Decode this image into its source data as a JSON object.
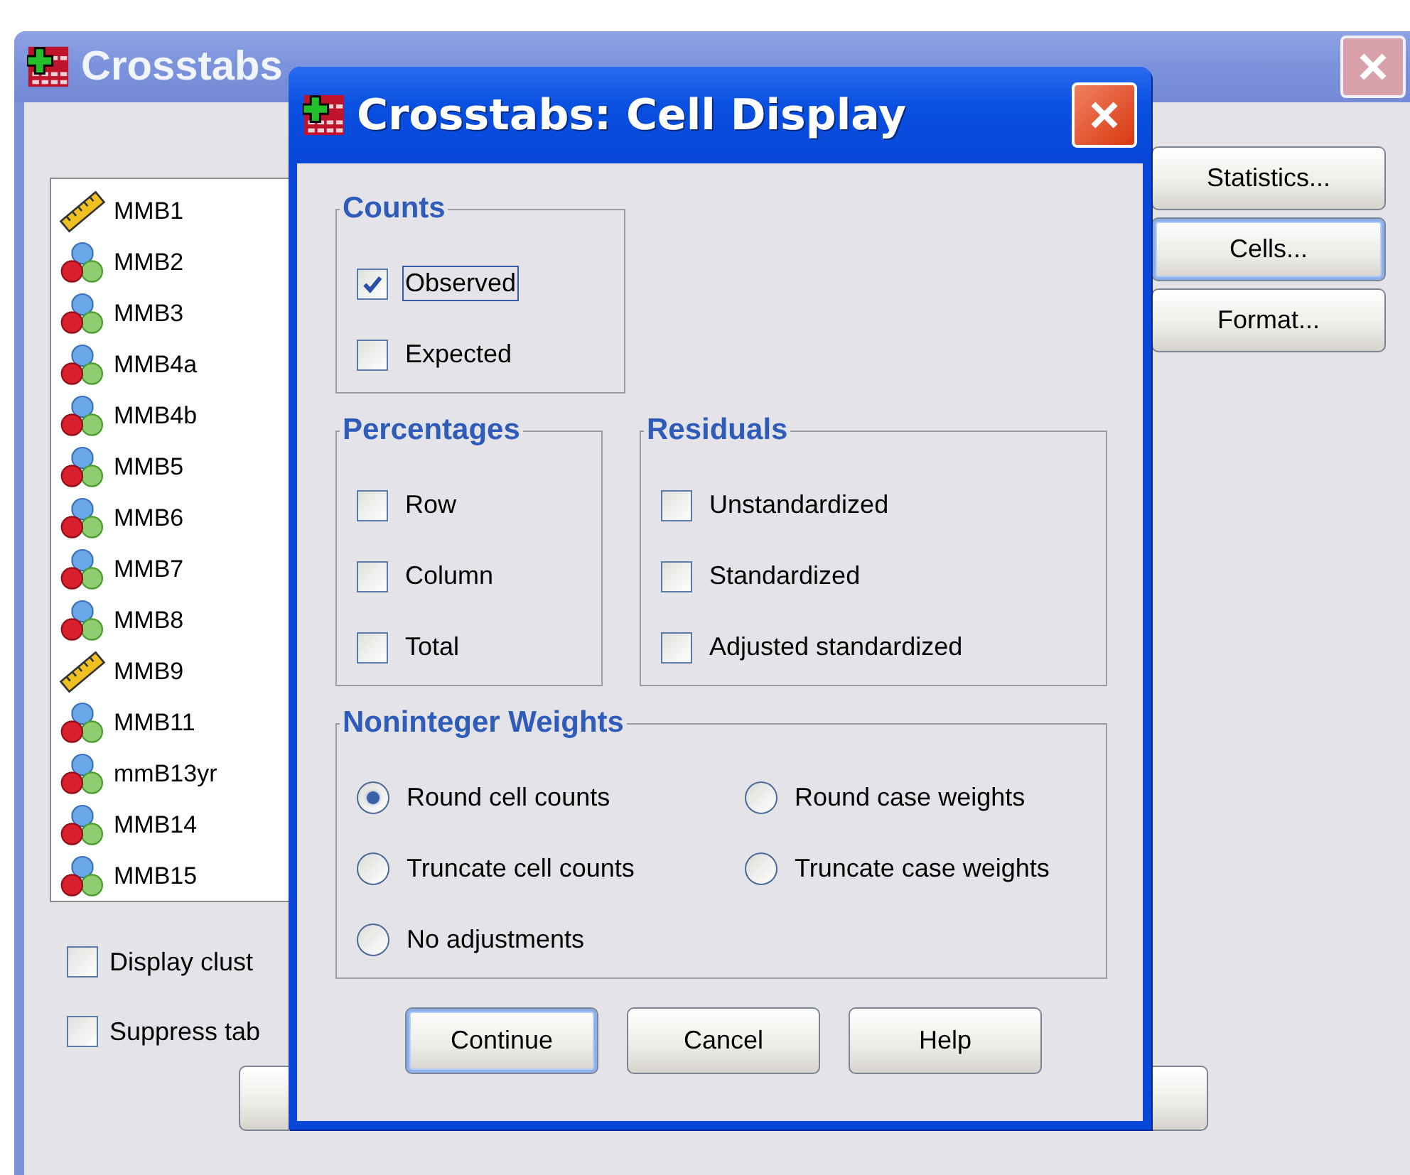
{
  "background_window": {
    "title": "Crosstabs",
    "variables": [
      {
        "name": "MMB1",
        "kind": "scale"
      },
      {
        "name": "MMB2",
        "kind": "nominal"
      },
      {
        "name": "MMB3",
        "kind": "nominal"
      },
      {
        "name": "MMB4a",
        "kind": "nominal"
      },
      {
        "name": "MMB4b",
        "kind": "nominal"
      },
      {
        "name": "MMB5",
        "kind": "nominal"
      },
      {
        "name": "MMB6",
        "kind": "nominal"
      },
      {
        "name": "MMB7",
        "kind": "nominal"
      },
      {
        "name": "MMB8",
        "kind": "nominal"
      },
      {
        "name": "MMB9",
        "kind": "scale"
      },
      {
        "name": "MMB11",
        "kind": "nominal"
      },
      {
        "name": "mmB13yr",
        "kind": "nominal"
      },
      {
        "name": "MMB14",
        "kind": "nominal"
      },
      {
        "name": "MMB15",
        "kind": "nominal"
      }
    ],
    "side_buttons": [
      {
        "label": "Statistics...",
        "focused": false
      },
      {
        "label": "Cells...",
        "focused": true
      },
      {
        "label": "Format...",
        "focused": false
      }
    ],
    "options": [
      {
        "label": "Display clust",
        "checked": false
      },
      {
        "label": "Suppress tab",
        "checked": false
      }
    ]
  },
  "dialog": {
    "title": "Crosstabs: Cell Display",
    "groups": [
      {
        "title": "Counts",
        "items": [
          {
            "kind": "checkbox",
            "label": "Observed",
            "checked": true,
            "focused": true
          },
          {
            "kind": "checkbox",
            "label": "Expected",
            "checked": false,
            "focused": false
          }
        ]
      },
      {
        "title": "Percentages",
        "items": [
          {
            "kind": "checkbox",
            "label": "Row",
            "checked": false,
            "focused": false
          },
          {
            "kind": "checkbox",
            "label": "Column",
            "checked": false,
            "focused": false
          },
          {
            "kind": "checkbox",
            "label": "Total",
            "checked": false,
            "focused": false
          }
        ]
      },
      {
        "title": "Residuals",
        "items": [
          {
            "kind": "checkbox",
            "label": "Unstandardized",
            "checked": false,
            "focused": false
          },
          {
            "kind": "checkbox",
            "label": "Standardized",
            "checked": false,
            "focused": false
          },
          {
            "kind": "checkbox",
            "label": "Adjusted standardized",
            "checked": false,
            "focused": false
          }
        ]
      },
      {
        "title": "Noninteger Weights",
        "items": [
          {
            "kind": "radio",
            "label": "Round cell counts",
            "selected": true,
            "focused": false
          },
          {
            "kind": "radio",
            "label": "Round case weights",
            "selected": false,
            "focused": false
          },
          {
            "kind": "radio",
            "label": "Truncate cell counts",
            "selected": false,
            "focused": false
          },
          {
            "kind": "radio",
            "label": "Truncate case weights",
            "selected": false,
            "focused": false
          },
          {
            "kind": "radio",
            "label": "No adjustments",
            "selected": false,
            "focused": false
          }
        ]
      }
    ],
    "buttons": [
      {
        "label": "Continue",
        "default": true
      },
      {
        "label": "Cancel",
        "default": false
      },
      {
        "label": "Help",
        "default": false
      }
    ]
  }
}
